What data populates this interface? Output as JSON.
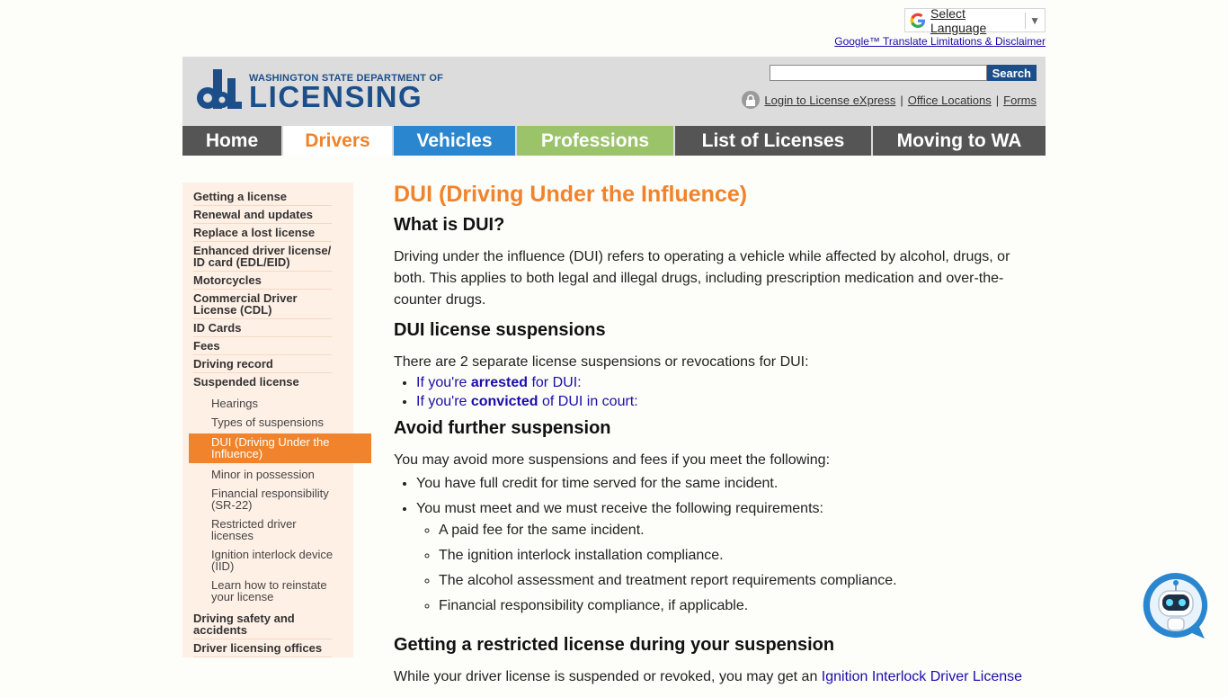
{
  "translate": {
    "select_label": "Select Language",
    "arrow": "▼",
    "disclaimer": "Google™ Translate Limitations & Disclaimer"
  },
  "header": {
    "logo_small": "WASHINGTON STATE DEPARTMENT OF",
    "logo_big": "LICENSING",
    "search_placeholder": "",
    "search_button": "Search",
    "login": "Login to License eXpress",
    "pipe1": "|",
    "offices": "Office Locations",
    "pipe2": "|",
    "forms": "Forms"
  },
  "nav": {
    "tabs": [
      "Home",
      "Drivers",
      "Vehicles",
      "Professions",
      "List of Licenses",
      "Moving to WA"
    ]
  },
  "sidebar": {
    "items": [
      "Getting a license",
      "Renewal and updates",
      "Replace a lost license",
      "Enhanced driver license/ ID card (EDL/EID)",
      "Motorcycles",
      "Commercial Driver License (CDL)",
      "ID Cards",
      "Fees",
      "Driving record",
      "Suspended license"
    ],
    "sub_items": [
      "Hearings",
      "Types of suspensions",
      "DUI (Driving Under the Influence)",
      "Minor in possession",
      "Financial responsibility (SR-22)",
      "Restricted driver licenses",
      "Ignition interlock device (IID)",
      "Learn how to reinstate your license"
    ],
    "bottom_items": [
      "Driving safety and accidents",
      "Driver licensing offices"
    ]
  },
  "main": {
    "title": "DUI (Driving Under the Influence)",
    "h_what": "What is DUI?",
    "p_what": "Driving under the influence (DUI) refers to operating a vehicle while affected by alcohol, drugs, or both. This applies to both legal and illegal drugs, including prescription medication and over-the-counter drugs.",
    "h_susp": "DUI license suspensions",
    "p_susp": "There are 2 separate license suspensions or revocations for DUI:",
    "link1_pre": "If you're ",
    "link1_bold": "arrested",
    "link1_post": " for DUI:",
    "link2_pre": "If you're ",
    "link2_bold": "convicted",
    "link2_post": " of DUI in court:",
    "h_avoid": "Avoid further suspension",
    "p_avoid": "You may avoid more suspensions and fees if you meet the following:",
    "bullet1": "You have full credit for time served for the same incident.",
    "bullet2": "You must meet and we must receive the following requirements:",
    "sub1": "A paid fee for the same incident.",
    "sub2": "The ignition interlock installation compliance.",
    "sub3": "The alcohol assessment and treatment report requirements compliance.",
    "sub4": "Financial responsibility compliance, if applicable.",
    "h_restricted": "Getting a restricted license during your suspension",
    "p_restricted": "While your driver license is suspended or revoked, you may get an ",
    "p_restricted_link": "Ignition Interlock Driver License"
  },
  "colors": {
    "orange": "#f0832b",
    "blue": "#2a86ce",
    "green": "#9ac36a",
    "gray": "#555555",
    "navy": "#1c4f8a"
  }
}
